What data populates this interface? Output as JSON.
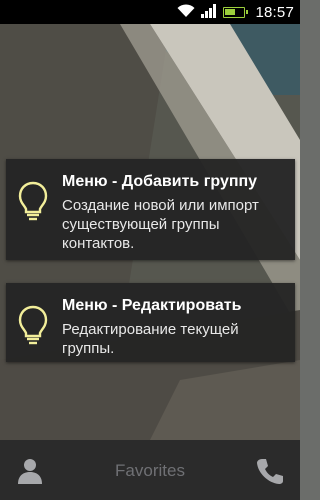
{
  "status_bar": {
    "time": "18:57",
    "wifi_icon": "wifi-icon",
    "signal_icon": "signal-icon",
    "battery_icon": "battery-icon",
    "battery_level": 0.6,
    "accent_color": "#9ccf3c"
  },
  "hints": [
    {
      "title": "Меню - Добавить группу",
      "description": "Создание новой или импорт существующей группы контактов.",
      "icon": "lightbulb-icon"
    },
    {
      "title": "Меню - Редактировать",
      "description": "Редактирование текущей группы.",
      "icon": "lightbulb-icon"
    }
  ],
  "bottom_bar": {
    "contacts_icon": "person-icon",
    "favorites_label": "Favorites",
    "phone_icon": "phone-icon"
  },
  "colors": {
    "bulb": "#f2ee9a",
    "card_bg": "#242424",
    "tab_inactive": "#6f7074"
  }
}
